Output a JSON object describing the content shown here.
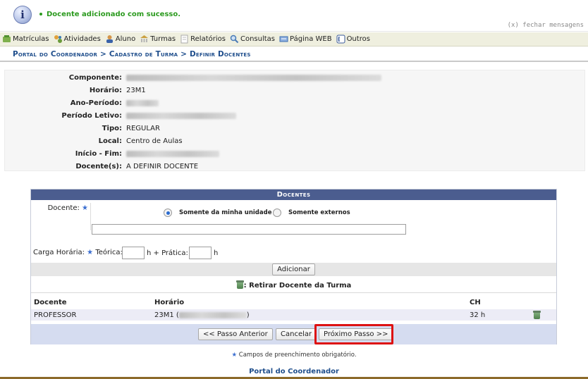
{
  "message": {
    "success_text": "Docente adicionado com sucesso.",
    "close_label": "(x) fechar mensagens"
  },
  "menu": {
    "items": [
      {
        "label": "Matrículas",
        "icon": "enrollment-icon",
        "color": "#4f8f2f"
      },
      {
        "label": "Atividades",
        "icon": "activities-icon",
        "color": "#d08b1a"
      },
      {
        "label": "Aluno",
        "icon": "student-icon",
        "color": "#c98a3a"
      },
      {
        "label": "Turmas",
        "icon": "classes-icon",
        "color": "#caa040"
      },
      {
        "label": "Relatórios",
        "icon": "reports-icon",
        "color": "#b9b9b9"
      },
      {
        "label": "Consultas",
        "icon": "search-icon",
        "color": "#4a7ab5"
      },
      {
        "label": "Página WEB",
        "icon": "web-page-icon",
        "color": "#3f6fb0"
      },
      {
        "label": "Outros",
        "icon": "phone-icon",
        "color": "#3a5a9a"
      }
    ]
  },
  "breadcrumb": {
    "text": "Portal do Coordenador > Cadastro de Turma > Definir Docentes"
  },
  "summary": {
    "rows": [
      {
        "label": "Componente:",
        "value": ""
      },
      {
        "label": "Horário:",
        "value": "23M1"
      },
      {
        "label": "Ano-Período:",
        "value": ""
      },
      {
        "label": "Período Letivo:",
        "value": ""
      },
      {
        "label": "Tipo:",
        "value": "REGULAR"
      },
      {
        "label": "Local:",
        "value": "Centro de Aulas"
      },
      {
        "label": "Início - Fim:",
        "value": ""
      },
      {
        "label": "Docente(s):",
        "value": "A DEFINIR DOCENTE"
      }
    ]
  },
  "form": {
    "header": "Docentes",
    "docente_label": "Docente:",
    "radio_own_unit": "Somente da minha unidade",
    "radio_external": "Somente externos",
    "radio_selected": "own_unit",
    "docente_value": "",
    "carga_label": "Carga Horária:",
    "teorica_label": "Teórica:",
    "teorica_value": "",
    "h_plus_pratica": "h + Prática:",
    "pratica_value": "",
    "h_suffix": "h",
    "add_button": "Adicionar",
    "remove_legend": ": Retirar Docente da Turma",
    "columns": [
      "Docente",
      "Horário",
      "CH"
    ],
    "rows": [
      {
        "docente": "PROFESSOR",
        "horario_prefix": "23M1 (",
        "horario_suffix": ")",
        "ch": "32 h"
      }
    ],
    "prev_button": "<< Passo Anterior",
    "cancel_button": "Cancelar",
    "next_button": "Próximo Passo >>"
  },
  "footnote": "Campos de preenchimento obrigatório.",
  "footer_link": "Portal do Coordenador",
  "colors": {
    "success": "#2b9a1e",
    "header_bg": "#4b5d8f",
    "link": "#1f4e8c",
    "highlight": "#dd1111"
  }
}
